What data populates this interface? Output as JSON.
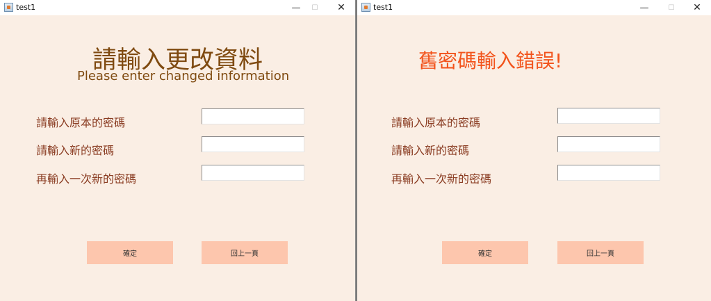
{
  "colors": {
    "window_bg": "#faeee4",
    "heading": "#7f4a10",
    "error": "#f2531b",
    "label": "#8a3c22",
    "button_bg": "#fdc6ad"
  },
  "windows": [
    {
      "title": "test1",
      "icon": "java-app-icon",
      "controls": {
        "minimize": "—",
        "maximize": "☐",
        "close": "✕"
      },
      "heading": "請輸入更改資料",
      "subheading": "Please enter changed information",
      "fields": [
        {
          "label": "請輸入原本的密碼",
          "value": ""
        },
        {
          "label": "請輸入新的密碼",
          "value": ""
        },
        {
          "label": "再輸入一次新的密碼",
          "value": ""
        }
      ],
      "buttons": {
        "confirm": "確定",
        "back": "回上一頁"
      }
    },
    {
      "title": "test1",
      "icon": "java-app-icon",
      "controls": {
        "minimize": "—",
        "maximize": "☐",
        "close": "✕"
      },
      "error_message": "舊密碼輸入錯誤!",
      "fields": [
        {
          "label": "請輸入原本的密碼",
          "value": ""
        },
        {
          "label": "請輸入新的密碼",
          "value": ""
        },
        {
          "label": "再輸入一次新的密碼",
          "value": ""
        }
      ],
      "buttons": {
        "confirm": "確定",
        "back": "回上一頁"
      }
    }
  ]
}
